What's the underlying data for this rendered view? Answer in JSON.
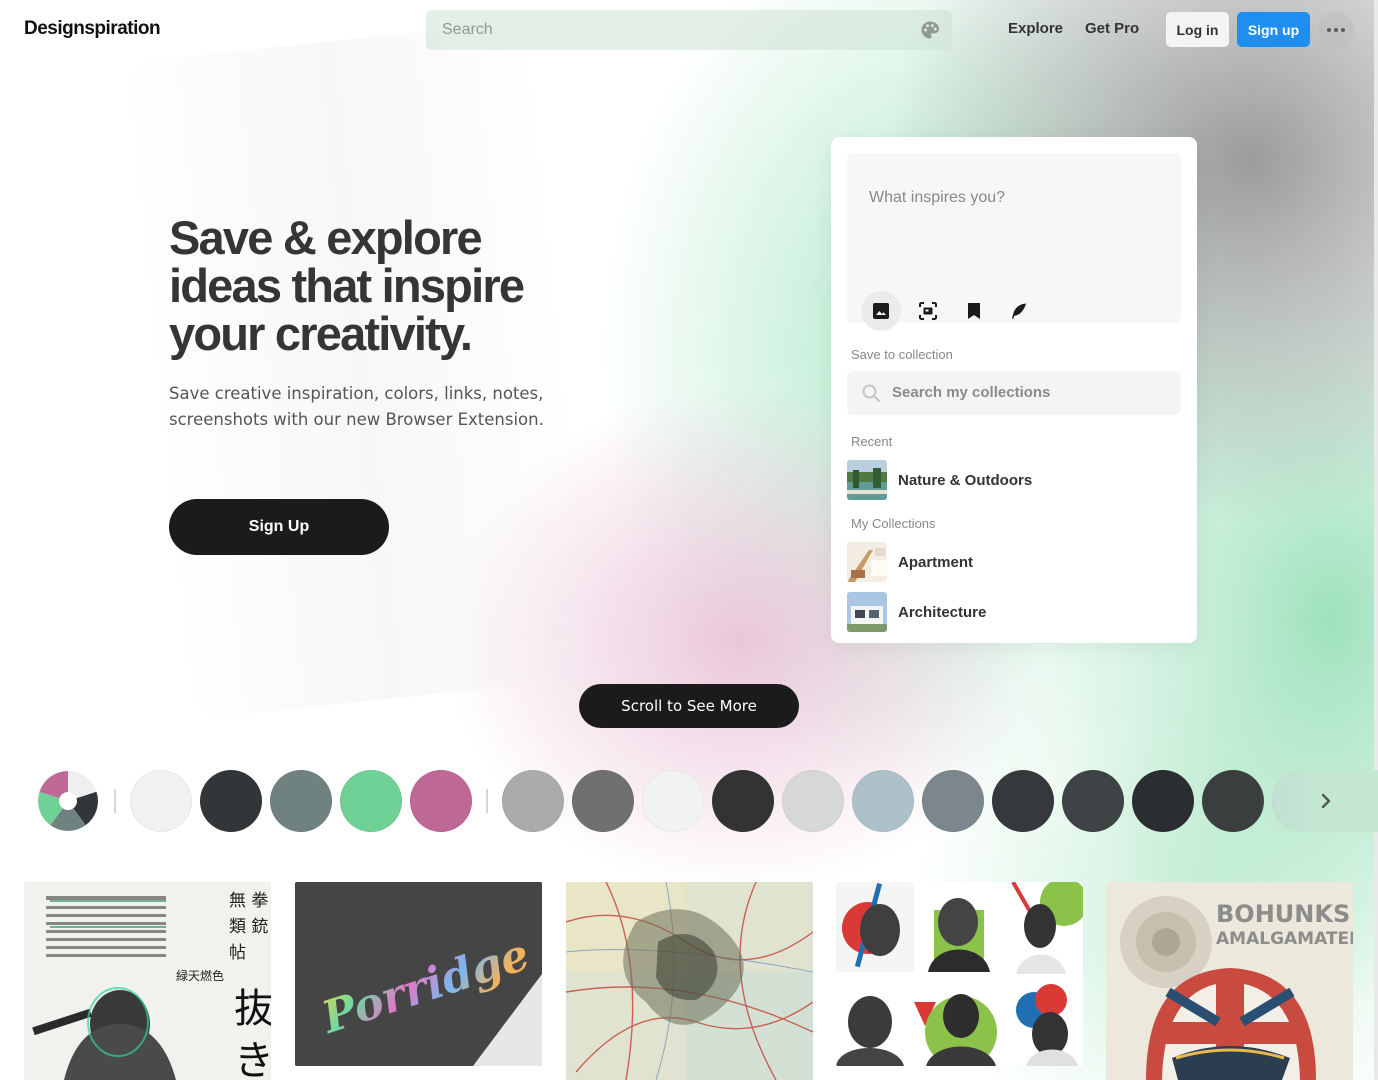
{
  "header": {
    "logo": "Designspiration",
    "search_placeholder": "Search",
    "nav": [
      "Explore",
      "Get Pro"
    ],
    "login": "Log in",
    "signup": "Sign up",
    "accent": "#1f8ef1"
  },
  "hero": {
    "title": "Save & explore ideas that inspire your creativity.",
    "subtitle": "Save creative inspiration, colors, links, notes, screenshots with our new Browser Extension.",
    "cta": "Sign Up"
  },
  "extension_card": {
    "composer_placeholder": "What inspires you?",
    "tools": [
      "image-icon",
      "screenshot-icon",
      "bookmark-icon",
      "feather-icon"
    ],
    "save_to_collection_label": "Save to collection",
    "collection_search_placeholder": "Search my collections",
    "recent_label": "Recent",
    "recent": [
      {
        "name": "Nature & Outdoors"
      }
    ],
    "my_collections_label": "My Collections",
    "collections": [
      {
        "name": "Apartment"
      },
      {
        "name": "Architecture"
      }
    ]
  },
  "scroll_button": "Scroll to See More",
  "color_wheel": [
    "#efefef",
    "#333639",
    "#6f8280",
    "#6fd196",
    "#be6895"
  ],
  "color_swatches_primary": [
    "#f0f1f0",
    "#333639",
    "#6f8280",
    "#6fd196",
    "#be6895"
  ],
  "color_swatches_secondary": [
    "#ababab",
    "#707070",
    "#f1f2f2",
    "#333333",
    "#d6d7d7",
    "#adc1c9",
    "#7c868d",
    "#36393b",
    "#3e4346",
    "#2b2e30",
    "#3a3e3f",
    "#c2dcd3"
  ],
  "tiles": [
    {
      "name": "poster-martial-arts",
      "height": 198
    },
    {
      "name": "porridge-holographic-card",
      "height": 184
    },
    {
      "name": "map-collage",
      "height": 198
    },
    {
      "name": "portrait-grid-shapes",
      "height": 184
    },
    {
      "name": "bohunks-amalgamated-poster",
      "height": 198,
      "text": "BOHUNKS AMALGAMATED"
    }
  ],
  "porridge_text": "Porridge"
}
